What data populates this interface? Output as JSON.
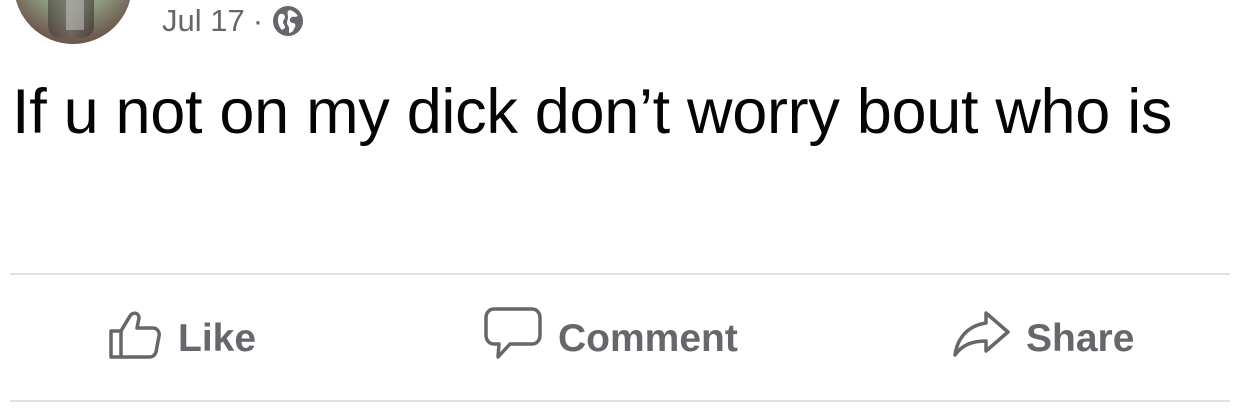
{
  "post": {
    "date": "Jul 17",
    "separator": "·",
    "privacy_icon": "globe-icon",
    "text": "If u not on my dick don’t worry bout who is"
  },
  "actions": {
    "like_label": "Like",
    "comment_label": "Comment",
    "share_label": "Share"
  },
  "colors": {
    "meta_text": "#65676b",
    "body_text": "#050505",
    "divider": "#dfe2e5"
  }
}
